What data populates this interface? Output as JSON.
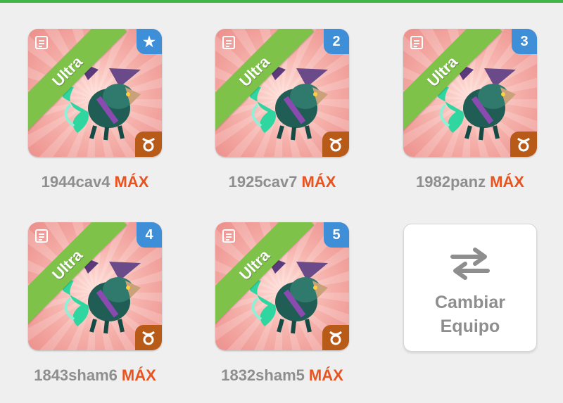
{
  "colors": {
    "accent_bar": "#3fb54a",
    "ribbon": "#7fc24a",
    "badge": "#3f8fd8",
    "zodiac_tab": "#b85a18",
    "level_text": "#e8531f",
    "name_text": "#8e8e8e"
  },
  "dragons": [
    {
      "tier": "Ultra",
      "badge": "★",
      "badge_icon": "star-icon",
      "zodiac_icon": "taurus-icon",
      "name": "1944cav4",
      "level": "MÁX"
    },
    {
      "tier": "Ultra",
      "badge": "2",
      "badge_icon": "",
      "zodiac_icon": "taurus-icon",
      "name": "1925cav7",
      "level": "MÁX"
    },
    {
      "tier": "Ultra",
      "badge": "3",
      "badge_icon": "",
      "zodiac_icon": "taurus-icon",
      "name": "1982panz",
      "level": "MÁX"
    },
    {
      "tier": "Ultra",
      "badge": "4",
      "badge_icon": "",
      "zodiac_icon": "taurus-icon",
      "name": "1843sham6",
      "level": "MÁX"
    },
    {
      "tier": "Ultra",
      "badge": "5",
      "badge_icon": "",
      "zodiac_icon": "taurus-icon",
      "name": "1832sham5",
      "level": "MÁX"
    }
  ],
  "swap_team": {
    "line1": "Cambiar",
    "line2": "Equipo",
    "icon": "swap-arrows-icon"
  }
}
